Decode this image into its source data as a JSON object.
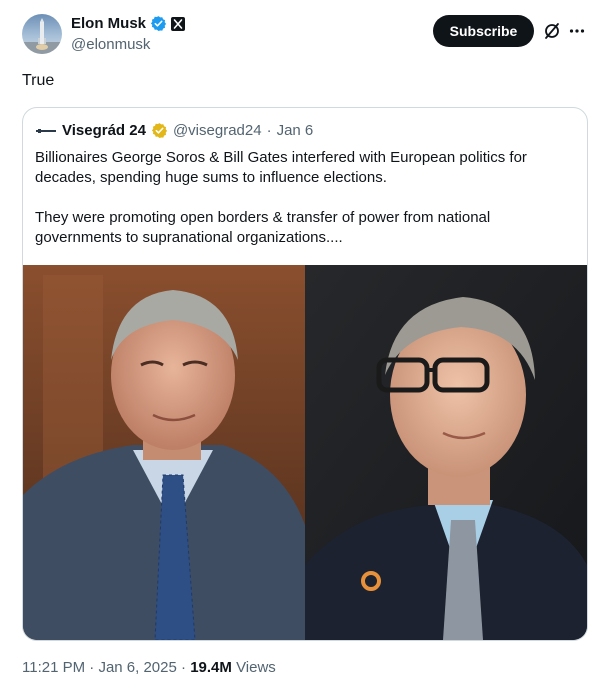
{
  "author": {
    "name": "Elon Musk",
    "handle": "@elonmusk",
    "verified": true,
    "affiliate_badge": "x-logo"
  },
  "actions": {
    "subscribe_label": "Subscribe",
    "grok_icon": "grok-icon",
    "more_icon": "more-icon"
  },
  "tweet": {
    "text": "True"
  },
  "quoted": {
    "name": "Visegrád 24",
    "handle": "@visegrad24",
    "separator": "·",
    "date": "Jan 6",
    "paragraph1": "Billionaires George Soros & Bill Gates interfered with European politics for decades, spending huge sums to influence elections.",
    "paragraph2": "They were promoting open borders & transfer of power from national governments to supranational organizations...."
  },
  "footer": {
    "time": "11:21 PM",
    "sep1": "·",
    "date": "Jan 6, 2025",
    "sep2": "·",
    "views": "19.4M",
    "views_label": "Views"
  },
  "colors": {
    "text": "#0f1419",
    "secondary": "#536471",
    "border": "#cfd9de",
    "verified_blue": "#1d9bf0",
    "verified_gold": "#e2b719"
  }
}
